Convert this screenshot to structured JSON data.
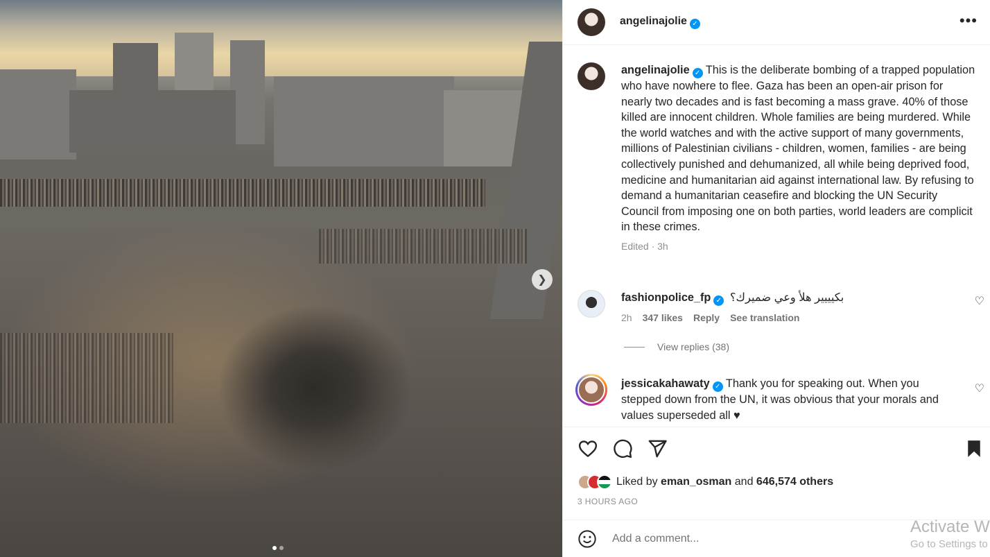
{
  "post": {
    "author": "angelinajolie",
    "menu_icon": "more-horizontal-icon",
    "caption_author": "angelinajolie",
    "caption": "This is the deliberate bombing of a trapped population who have nowhere to flee. Gaza has been an open-air prison for nearly two decades and is fast becoming a mass grave. 40% of those killed are innocent children. Whole families are being murdered. While the world watches and with the active support of many governments, millions of Palestinian civilians - children, women, families - are being collectively punished and dehumanized, all while being deprived food, medicine and humanitarian aid against international law. By refusing to demand a humanitarian ceasefire and blocking the UN Security Council from imposing one on both parties, world leaders are complicit in these crimes.",
    "caption_meta": "Edited · 3h"
  },
  "comments": [
    {
      "user": "fashionpolice_fp",
      "text": "بكيييير هلأ وعي ضميرك؟",
      "time": "2h",
      "likes": "347 likes",
      "reply": "Reply",
      "translate": "See translation",
      "view_replies": "View replies (38)"
    },
    {
      "user": "jessicakahawaty",
      "text": "Thank you for speaking out. When you stepped down from the UN, it was obvious that your morals and values superseded all ♥"
    }
  ],
  "actions": {
    "like_icon": "heart-icon",
    "comment_icon": "comment-icon",
    "share_icon": "send-icon",
    "save_icon": "bookmark-icon"
  },
  "likes": {
    "prefix": "Liked by",
    "user": "eman_osman",
    "joiner": "and",
    "others": "646,574 others"
  },
  "timestamp": "3 HOURS AGO",
  "add_comment": {
    "placeholder": "Add a comment..."
  },
  "watermark": {
    "line1": "Activate Windows",
    "line2": "Go to Settings to activate Windows."
  },
  "colors": {
    "verified": "#0095f6",
    "text": "#262626",
    "muted": "#8e8e8e"
  }
}
